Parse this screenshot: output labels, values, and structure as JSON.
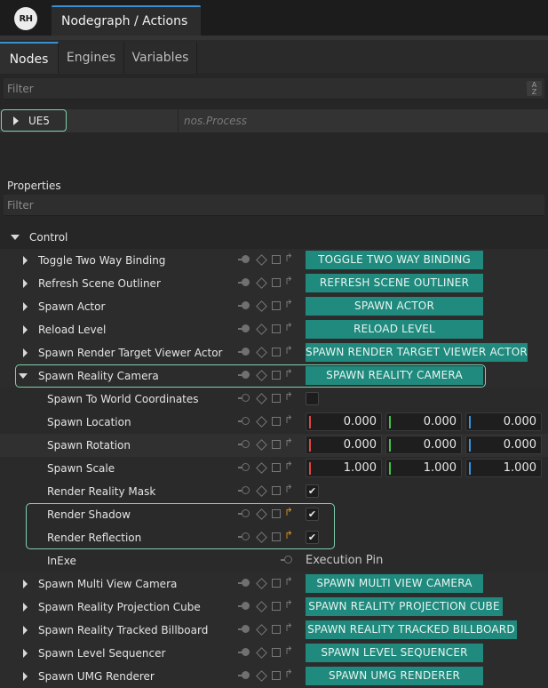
{
  "app": {
    "logo_text": "RH",
    "doc_tab": "Nodegraph / Actions"
  },
  "tabs": [
    {
      "label": "Nodes"
    },
    {
      "label": "Engines"
    },
    {
      "label": "Variables"
    }
  ],
  "top_filter": {
    "placeholder": "Filter"
  },
  "tree": {
    "item": "UE5",
    "process": "nos.Process"
  },
  "properties": {
    "label": "Properties",
    "filter": "Filter"
  },
  "control": {
    "label": "Control",
    "actions_top": [
      {
        "label": "Toggle Two Way Binding",
        "button": "TOGGLE TWO WAY BINDING"
      },
      {
        "label": "Refresh Scene Outliner",
        "button": "REFRESH SCENE OUTLINER"
      },
      {
        "label": "Spawn Actor",
        "button": "SPAWN ACTOR"
      },
      {
        "label": "Reload Level",
        "button": "RELOAD LEVEL"
      },
      {
        "label": "Spawn Render Target Viewer Actor",
        "button": "SPAWN RENDER TARGET VIEWER ACTOR"
      }
    ],
    "camera": {
      "label": "Spawn Reality Camera",
      "button": "SPAWN REALITY CAMERA",
      "world_coords": "Spawn To World Coordinates",
      "location": {
        "label": "Spawn Location",
        "x": "0.000",
        "y": "0.000",
        "z": "0.000"
      },
      "rotation": {
        "label": "Spawn Rotation",
        "x": "0.000",
        "y": "0.000",
        "z": "0.000"
      },
      "scale": {
        "label": "Spawn Scale",
        "x": "1.000",
        "y": "1.000",
        "z": "1.000"
      },
      "mask": "Render Reality Mask",
      "shadow": "Render Shadow",
      "reflection": "Render Reflection",
      "inexe": {
        "label": "InExe",
        "value": "Execution Pin"
      }
    },
    "actions_bottom": [
      {
        "label": "Spawn Multi View Camera",
        "button": "SPAWN MULTI VIEW CAMERA"
      },
      {
        "label": "Spawn Reality Projection Cube",
        "button": "SPAWN REALITY PROJECTION CUBE"
      },
      {
        "label": "Spawn Reality Tracked Billboard",
        "button": "SPAWN REALITY TRACKED BILLBOARD"
      },
      {
        "label": "Spawn Level Sequencer",
        "button": "SPAWN LEVEL SEQUENCER"
      },
      {
        "label": "Spawn UMG Renderer",
        "button": "SPAWN UMG RENDERER"
      }
    ]
  },
  "checkmark": "✔",
  "colors": {
    "accent": "#3a8fd0",
    "action_button": "#1f8a7d",
    "highlight": "#7fd1ad",
    "exec_orange": "#d18a1f"
  }
}
